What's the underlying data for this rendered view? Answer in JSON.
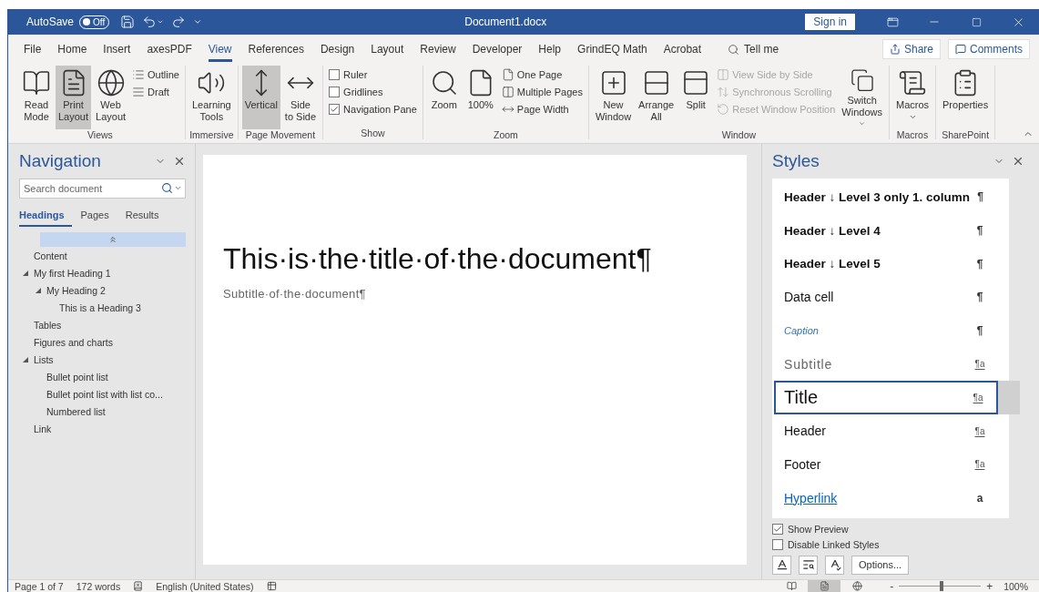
{
  "title_bar": {
    "autosave_label": "AutoSave",
    "autosave": {
      "on": false,
      "label": "Off"
    },
    "title": "Document1.docx",
    "sign_in": "Sign in"
  },
  "menu_tabs": [
    {
      "label": "File",
      "selected": false
    },
    {
      "label": "Home",
      "selected": false
    },
    {
      "label": "Insert",
      "selected": false
    },
    {
      "label": "axesPDF",
      "selected": false
    },
    {
      "label": "View",
      "selected": true
    },
    {
      "label": "References",
      "selected": false
    },
    {
      "label": "Design",
      "selected": false
    },
    {
      "label": "Layout",
      "selected": false
    },
    {
      "label": "Review",
      "selected": false
    },
    {
      "label": "Developer",
      "selected": false
    },
    {
      "label": "Help",
      "selected": false
    },
    {
      "label": "GrindEQ Math",
      "selected": false
    },
    {
      "label": "Acrobat",
      "selected": false
    }
  ],
  "tell_me": "Tell me",
  "share": "Share",
  "comments": "Comments",
  "ribbon": {
    "groups": [
      {
        "label": "Views",
        "items": [
          {
            "kind": "large",
            "lines": [
              "Read",
              "Mode"
            ],
            "selected": false,
            "dropdown": false
          },
          {
            "kind": "large",
            "lines": [
              "Print",
              "Layout"
            ],
            "selected": true,
            "dropdown": false
          },
          {
            "kind": "large",
            "lines": [
              "Web",
              "Layout"
            ],
            "selected": false,
            "dropdown": false
          },
          {
            "kind": "stack",
            "entries": [
              {
                "kind": "small",
                "label": "Outline",
                "disabled": false
              },
              {
                "kind": "small",
                "label": "Draft",
                "disabled": false
              }
            ]
          }
        ]
      },
      {
        "label": "Immersive",
        "items": [
          {
            "kind": "large",
            "lines": [
              "Learning",
              "Tools"
            ],
            "selected": false,
            "dropdown": false
          }
        ]
      },
      {
        "label": "Page Movement",
        "items": [
          {
            "kind": "large",
            "lines": [
              "Vertical"
            ],
            "selected": true,
            "dropdown": false
          },
          {
            "kind": "large",
            "lines": [
              "Side",
              "to Side"
            ],
            "selected": false,
            "dropdown": false
          }
        ]
      },
      {
        "label": "Show",
        "items": [
          {
            "kind": "stack",
            "entries": [
              {
                "kind": "check",
                "label": "Ruler",
                "checked": false
              },
              {
                "kind": "check",
                "label": "Gridlines",
                "checked": false
              },
              {
                "kind": "check",
                "label": "Navigation Pane",
                "checked": true
              }
            ]
          }
        ]
      },
      {
        "label": "Zoom",
        "items": [
          {
            "kind": "large",
            "lines": [
              "Zoom"
            ],
            "selected": false,
            "dropdown": false
          },
          {
            "kind": "large",
            "lines": [
              "100%"
            ],
            "selected": false,
            "dropdown": false
          },
          {
            "kind": "stack",
            "entries": [
              {
                "kind": "small",
                "label": "One Page",
                "disabled": false
              },
              {
                "kind": "small",
                "label": "Multiple Pages",
                "disabled": false
              },
              {
                "kind": "small",
                "label": "Page Width",
                "disabled": false
              }
            ]
          }
        ]
      },
      {
        "label": "Window",
        "items": [
          {
            "kind": "large",
            "lines": [
              "New",
              "Window"
            ],
            "selected": false,
            "dropdown": false
          },
          {
            "kind": "large",
            "lines": [
              "Arrange",
              "All"
            ],
            "selected": false,
            "dropdown": false
          },
          {
            "kind": "large",
            "lines": [
              "Split"
            ],
            "selected": false,
            "dropdown": false
          },
          {
            "kind": "stack",
            "entries": [
              {
                "kind": "small",
                "label": "View Side by Side",
                "disabled": true
              },
              {
                "kind": "small",
                "label": "Synchronous Scrolling",
                "disabled": true
              },
              {
                "kind": "small",
                "label": "Reset Window Position",
                "disabled": true
              }
            ]
          },
          {
            "kind": "large",
            "lines": [
              "Switch",
              "Windows"
            ],
            "selected": false,
            "dropdown": true
          }
        ]
      },
      {
        "label": "Macros",
        "items": [
          {
            "kind": "large",
            "lines": [
              "Macros"
            ],
            "selected": false,
            "dropdown": true
          }
        ]
      },
      {
        "label": "SharePoint",
        "items": [
          {
            "kind": "large",
            "lines": [
              "Properties"
            ],
            "selected": false,
            "dropdown": false
          }
        ]
      }
    ]
  },
  "navigation": {
    "title": "Navigation",
    "search_placeholder": "Search document",
    "tabs": [
      {
        "label": "Headings",
        "selected": true
      },
      {
        "label": "Pages",
        "selected": false
      },
      {
        "label": "Results",
        "selected": false
      }
    ],
    "headings": [
      {
        "label": "Content"
      },
      {
        "label": "My first Heading 1",
        "expanded": true,
        "children": [
          {
            "label": "My Heading 2",
            "expanded": true,
            "children": [
              {
                "label": "This is a Heading 3"
              }
            ]
          }
        ]
      },
      {
        "label": "Tables"
      },
      {
        "label": "Figures and charts"
      },
      {
        "label": "Lists",
        "expanded": true,
        "children": [
          {
            "label": "Bullet point list"
          },
          {
            "label": "Bullet point list with list co..."
          },
          {
            "label": "Numbered list"
          }
        ]
      },
      {
        "label": "Link"
      }
    ]
  },
  "document": {
    "title": "This·is·the·title·of·the·document¶",
    "subtitle": "Subtitle·of·the·document¶"
  },
  "styles": {
    "title": "Styles",
    "items": [
      {
        "name": "Header ↓ Level 3 only 1. column",
        "mark": "¶",
        "kind": "bold",
        "linked": false,
        "selected": false
      },
      {
        "name": "Header ↓ Level 4",
        "mark": "¶",
        "kind": "bold",
        "linked": false,
        "selected": false
      },
      {
        "name": "Header ↓ Level 5",
        "mark": "¶",
        "kind": "bold",
        "linked": false,
        "selected": false
      },
      {
        "name": "Data cell",
        "mark": "¶",
        "kind": "plain",
        "linked": false,
        "selected": false
      },
      {
        "name": "Caption",
        "mark": "¶",
        "kind": "caption",
        "linked": false,
        "selected": false
      },
      {
        "name": "Subtitle",
        "mark": "¶a",
        "kind": "subtitle",
        "linked": true,
        "selected": false
      },
      {
        "name": "Title",
        "mark": "¶a",
        "kind": "title",
        "linked": true,
        "selected": true
      },
      {
        "name": "Header",
        "mark": "¶a",
        "kind": "plain",
        "linked": true,
        "selected": false
      },
      {
        "name": "Footer",
        "mark": "¶a",
        "kind": "plain",
        "linked": true,
        "selected": false
      },
      {
        "name": "Hyperlink",
        "mark": "a",
        "kind": "link",
        "linked": false,
        "selected": false
      }
    ],
    "options": [
      {
        "label": "Show Preview",
        "checked": true
      },
      {
        "label": "Disable Linked Styles",
        "checked": false
      }
    ],
    "options_button": "Options..."
  },
  "status_bar": {
    "page": "Page 1 of 7",
    "words": "172 words",
    "language": "English (United States)",
    "views": [
      {
        "selected": false
      },
      {
        "selected": true
      },
      {
        "selected": false
      }
    ],
    "zoom": {
      "minus": "-",
      "plus": "+",
      "level": 0.52,
      "label": "100%"
    }
  }
}
